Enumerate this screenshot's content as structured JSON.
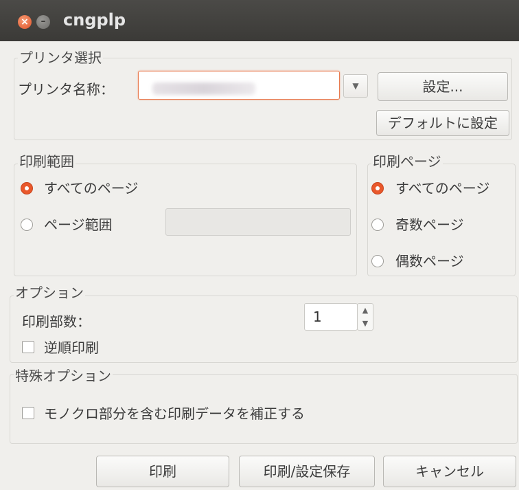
{
  "window": {
    "title": "cngplp",
    "close_glyph": "×",
    "minimize_glyph": "–"
  },
  "printer_select": {
    "group_label": "プリンタ選択",
    "name_label": "プリンタ名称：",
    "dropdown_arrow": "▼",
    "settings_button": "設定...",
    "set_default_button": "デフォルトに設定"
  },
  "print_range": {
    "group_label": "印刷範囲",
    "all_pages": "すべてのページ",
    "page_range": "ページ範囲",
    "selected": "all_pages"
  },
  "print_pages": {
    "group_label": "印刷ページ",
    "all_pages": "すべてのページ",
    "odd_pages": "奇数ページ",
    "even_pages": "偶数ページ",
    "selected": "all_pages"
  },
  "options": {
    "group_label": "オプション",
    "copies_label": "印刷部数：",
    "copies_value": "1",
    "spin_up": "▲",
    "spin_down": "▼",
    "reverse_label": "逆順印刷",
    "reverse_checked": false
  },
  "special_options": {
    "group_label": "特殊オプション",
    "mono_correct_label": "モノクロ部分を含む印刷データを補正する",
    "mono_correct_checked": false
  },
  "footer": {
    "print_button": "印刷",
    "print_save_button": "印刷/設定保存",
    "cancel_button": "キャンセル"
  },
  "colors": {
    "accent": "#e9582b",
    "titlebar": "#3c3b37",
    "window_bg": "#f0efec"
  }
}
